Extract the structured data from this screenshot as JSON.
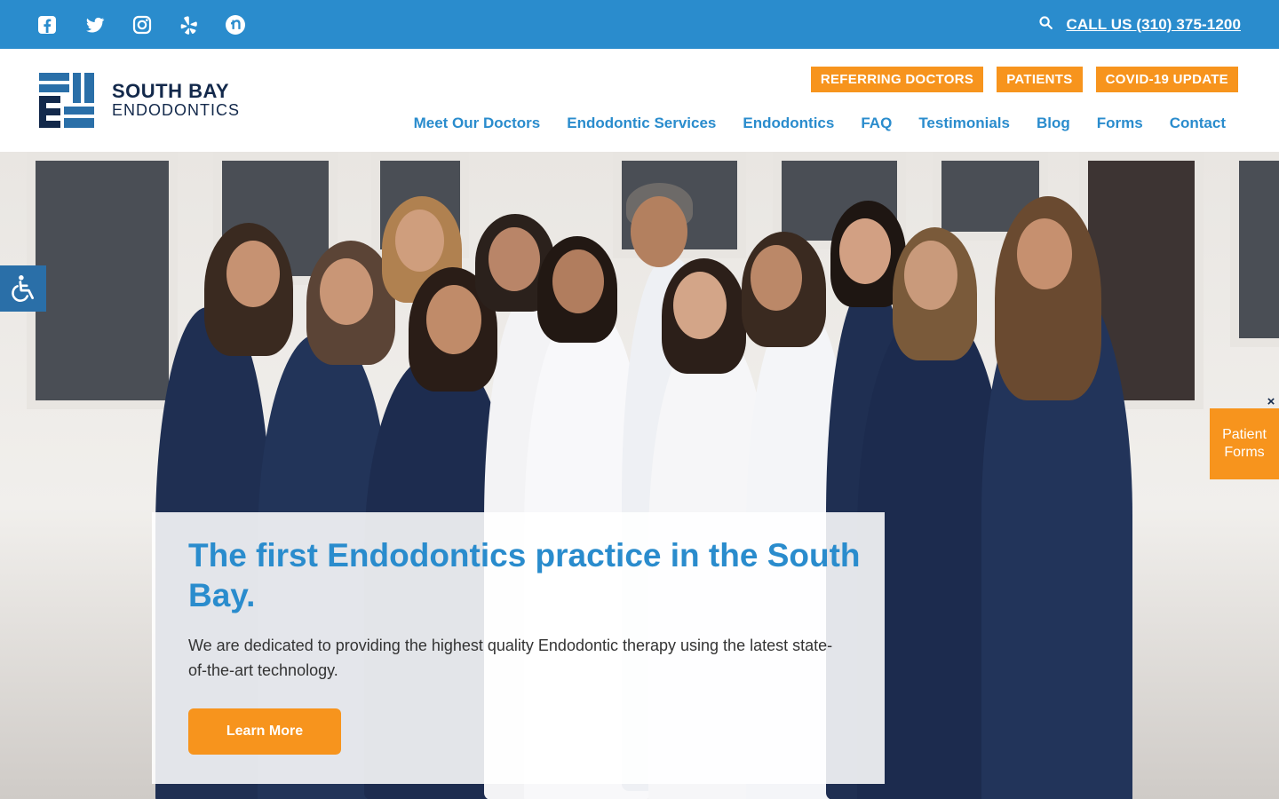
{
  "topbar": {
    "social": [
      "facebook-icon",
      "twitter-icon",
      "instagram-icon",
      "yelp-icon",
      "nextdoor-icon"
    ],
    "call_label": "CALL US (310) 375-1200",
    "accent": "#2a8ccd"
  },
  "logo": {
    "line1": "SOUTH BAY",
    "line2": "ENDODONTICS",
    "color": "#13294b"
  },
  "header": {
    "pills": [
      "REFERRING DOCTORS",
      "PATIENTS",
      "COVID-19 UPDATE"
    ],
    "nav": [
      "Meet Our Doctors",
      "Endodontic Services",
      "Endodontics",
      "FAQ",
      "Testimonials",
      "Blog",
      "Forms",
      "Contact"
    ],
    "pill_color": "#f7941d"
  },
  "hero": {
    "title": "The first Endodontics practice in the South Bay.",
    "text": "We are dedicated to providing the highest quality Endodontic therapy using the latest state-of-the-art technology.",
    "button": "Learn More"
  },
  "widgets": {
    "close": "×",
    "patient_forms_1": "Patient",
    "patient_forms_2": "Forms",
    "accessibility_icon": "wheelchair-icon"
  }
}
